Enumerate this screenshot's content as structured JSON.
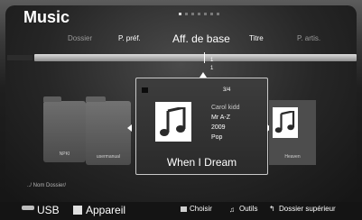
{
  "header": {
    "title": "Music",
    "page_indicator": {
      "total": 7,
      "current": 1
    }
  },
  "tabs": [
    {
      "label": "Dossier"
    },
    {
      "label": "P. préf."
    },
    {
      "label": "Aff. de base"
    },
    {
      "label": "Titre"
    },
    {
      "label": "P. artis."
    }
  ],
  "timeline": {
    "marker_top": "1",
    "marker_bottom": "1"
  },
  "items": [
    {
      "label": "NPKI"
    },
    {
      "label": "usermanual"
    },
    {
      "label": "Heaven"
    }
  ],
  "focused": {
    "counter": "3/4",
    "artist": "Carol kidd",
    "sort": "Mr A-Z",
    "year": "2009",
    "genre": "Pop",
    "title": "When I Dream"
  },
  "path": "../ Nom Dossier/",
  "footer": {
    "usb_label": "USB",
    "device_label": "Appareil",
    "choose_label": "Choisir",
    "tools_label": "Outils",
    "return_label": "Dossier supérieur"
  },
  "icons": {
    "usb": "usb-icon",
    "device": "device-icon",
    "tools": "tools-icon",
    "return": "return-icon",
    "music_note": "music-note-icon"
  }
}
